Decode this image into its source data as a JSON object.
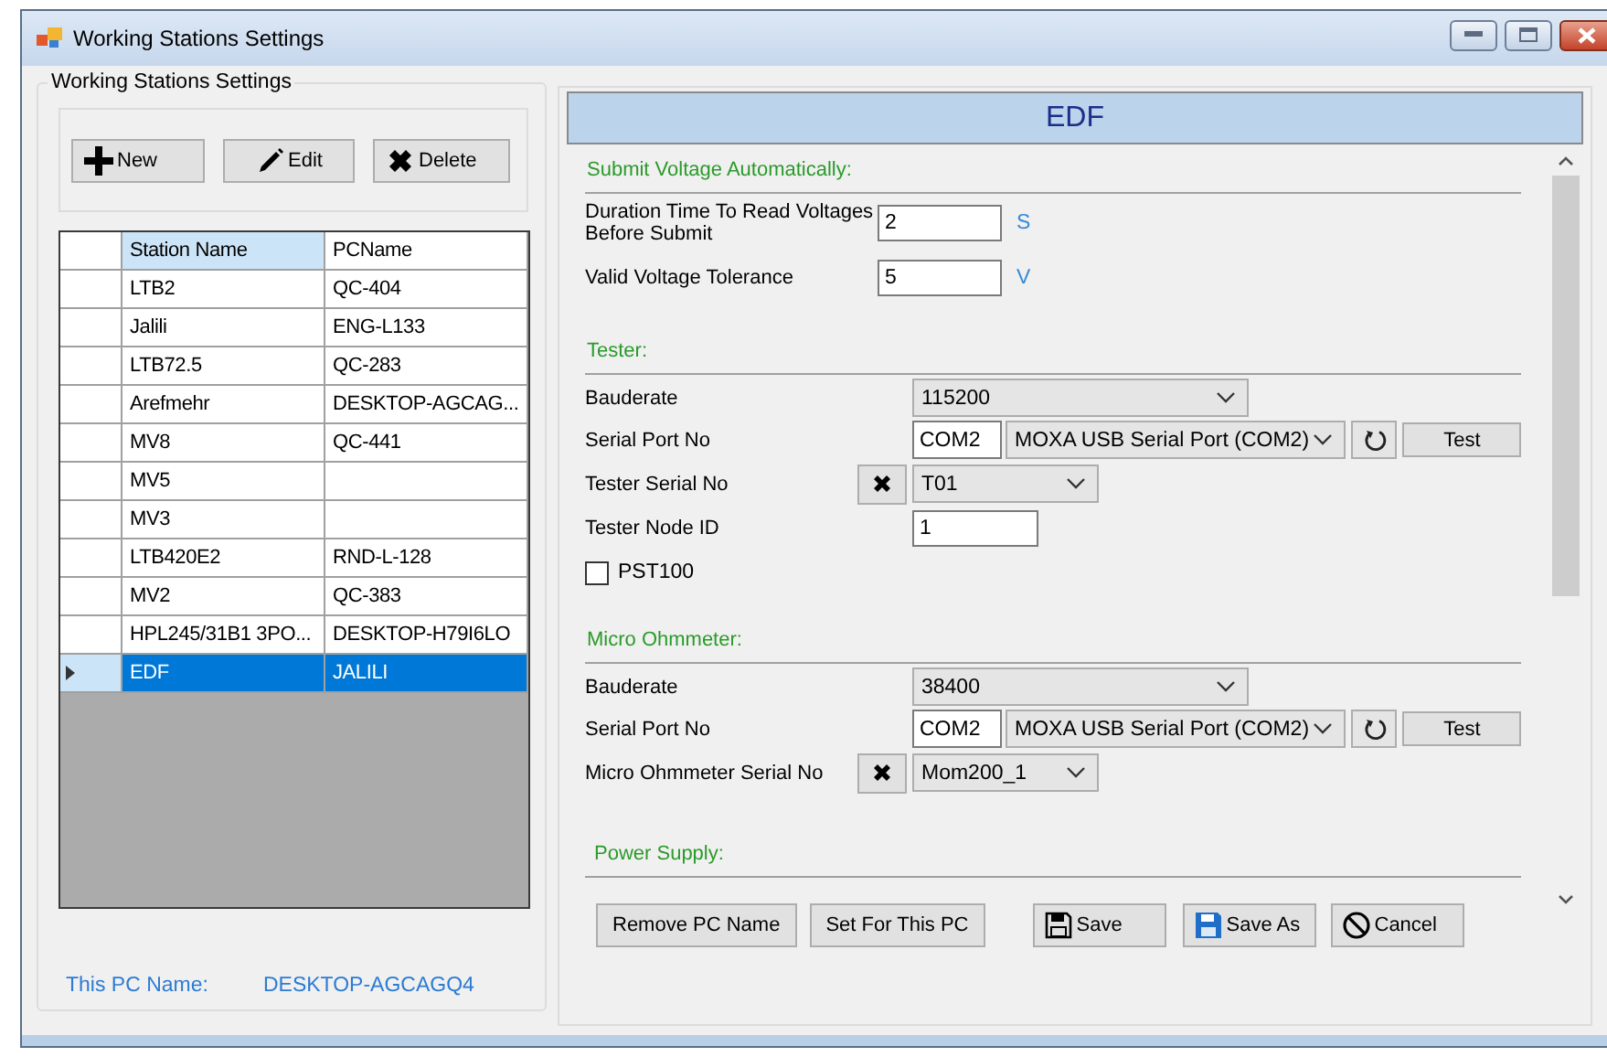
{
  "window": {
    "title": "Working Stations Settings"
  },
  "stations": {
    "group_title": "Working Stations Settings",
    "toolbar": [
      {
        "label": "New",
        "kind": "add"
      },
      {
        "label": "Edit",
        "kind": "edit"
      },
      {
        "label": "Delete",
        "kind": "delete"
      }
    ],
    "columns": [
      {
        "label": "Station Name",
        "selected": true
      },
      {
        "label": "PCName",
        "selected": false
      }
    ],
    "rows": [
      {
        "station_name": "LTB2",
        "pc_name": "QC-404",
        "selected": false
      },
      {
        "station_name": "Jalili",
        "pc_name": "ENG-L133",
        "selected": false
      },
      {
        "station_name": "LTB72.5",
        "pc_name": "QC-283",
        "selected": false
      },
      {
        "station_name": "Arefmehr",
        "pc_name": "DESKTOP-AGCAG...",
        "selected": false
      },
      {
        "station_name": "MV8",
        "pc_name": "QC-441",
        "selected": false
      },
      {
        "station_name": "MV5",
        "selected": false
      },
      {
        "station_name": "MV3",
        "selected": false
      },
      {
        "station_name": "LTB420E2",
        "pc_name": "RND-L-128",
        "selected": false
      },
      {
        "station_name": "MV2",
        "pc_name": "QC-383",
        "selected": false
      },
      {
        "station_name": "HPL245/31B1 3PO...",
        "pc_name": "DESKTOP-H79I6LO",
        "selected": false
      },
      {
        "station_name": "EDF",
        "pc_name": "JALILI",
        "selected": true
      }
    ],
    "this_pc": {
      "label": "This PC Name:",
      "value": "DESKTOP-AGCAGQ4"
    }
  },
  "settings": {
    "header": "EDF",
    "sections": [
      {
        "title": "Submit Voltage Automatically:",
        "fields": [
          {
            "kind": "unit",
            "label": "Duration Time To Read Voltages Before Submit",
            "value": "2",
            "unit": "S"
          },
          {
            "kind": "unit",
            "label": "Valid Voltage Tolerance",
            "value": "5",
            "unit": "V"
          }
        ]
      },
      {
        "title": "Tester:",
        "fields": [
          {
            "kind": "combo",
            "label": "Bauderate",
            "value": "115200"
          },
          {
            "kind": "port",
            "label": "Serial Port No",
            "port": "COM2",
            "device": "MOXA USB Serial Port (COM2)",
            "button": "Test"
          },
          {
            "kind": "serial",
            "label": "Tester Serial No",
            "value": "T01"
          },
          {
            "kind": "text",
            "label": "Tester Node ID",
            "value": "1"
          },
          {
            "kind": "checkbox",
            "label": "PST100",
            "checked": false
          }
        ]
      },
      {
        "title": "Micro Ohmmeter:",
        "fields": [
          {
            "kind": "combo",
            "label": "Bauderate",
            "value": "38400"
          },
          {
            "kind": "port",
            "label": "Serial Port No",
            "port": "COM2",
            "device": "MOXA USB Serial Port (COM2)",
            "button": "Test"
          },
          {
            "kind": "serial",
            "label": "Micro Ohmmeter Serial No",
            "value": "Mom200_1"
          }
        ]
      },
      {
        "title": "Power Supply:"
      }
    ],
    "buttons": [
      {
        "label": "Remove PC Name",
        "kind": "plain"
      },
      {
        "label": "Set For This PC",
        "kind": "plain"
      },
      {
        "label": "Save",
        "kind": "save"
      },
      {
        "label": "Save As",
        "kind": "save_as"
      },
      {
        "label": "Cancel",
        "kind": "cancel"
      }
    ]
  }
}
